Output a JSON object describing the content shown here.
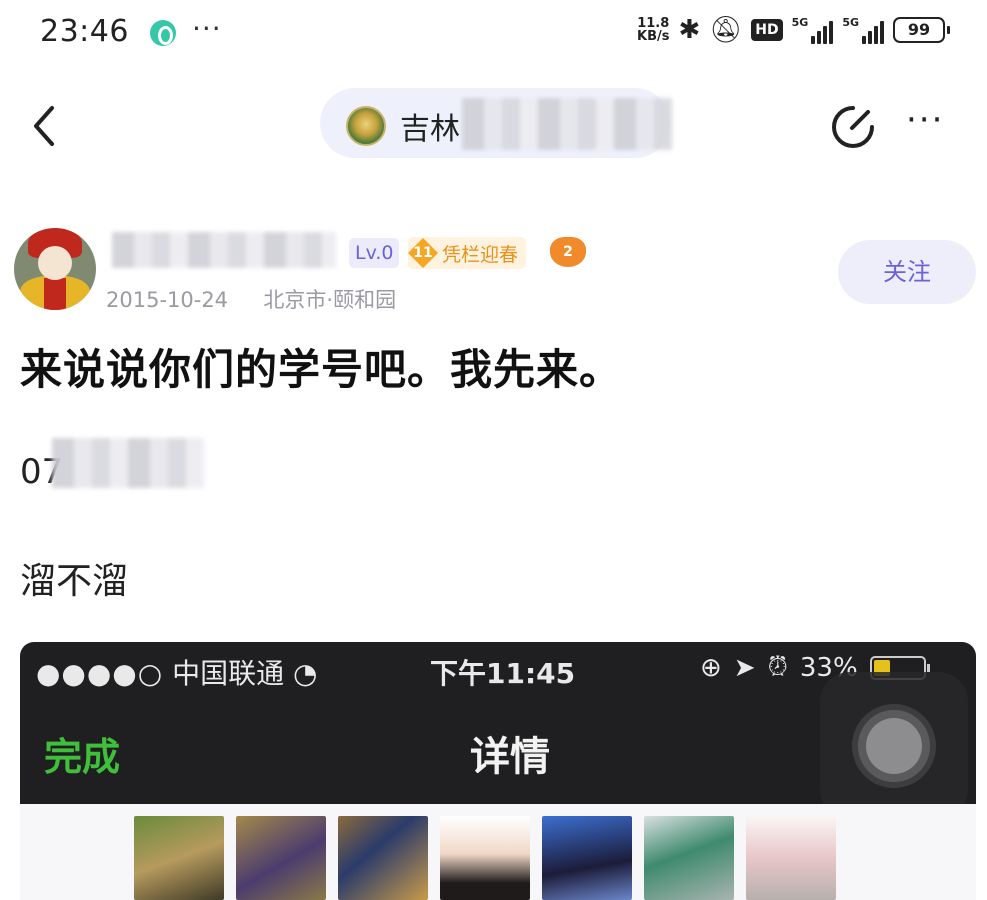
{
  "status_bar": {
    "time": "23:46",
    "dots": "···",
    "speed_value": "11.8",
    "speed_unit": "KB/s",
    "bluetooth_icon": "bluetooth-icon",
    "mute_icon": "bell-off-icon",
    "hd_label": "HD",
    "net1_tag": "5G",
    "net2_tag": "5G",
    "battery": "99"
  },
  "nav": {
    "title_visible": "吉林",
    "back_icon": "chevron-left-icon",
    "edit_icon": "edit-circle-icon",
    "more": "···"
  },
  "post": {
    "author_level": "Lv.0",
    "honor_level": "11",
    "honor_title": "凭栏迎春",
    "game_badge": "2",
    "date": "2015-10-24",
    "location": "北京市·颐和园",
    "follow_label": "关注",
    "title": "来说说你们的学号吧。我先来。",
    "line1_visible": "07",
    "line2": "溜不溜"
  },
  "embed": {
    "carrier_dots": "●●●●○",
    "carrier": "中国联通",
    "time": "下午11:45",
    "battery_percent": "33%",
    "battery_level": 0.33,
    "done_label": "完成",
    "title": "详情"
  },
  "colors": {
    "accent": "#6a62d8",
    "pill_bg": "#eef1fb",
    "embed_green": "#3fbf3a"
  }
}
